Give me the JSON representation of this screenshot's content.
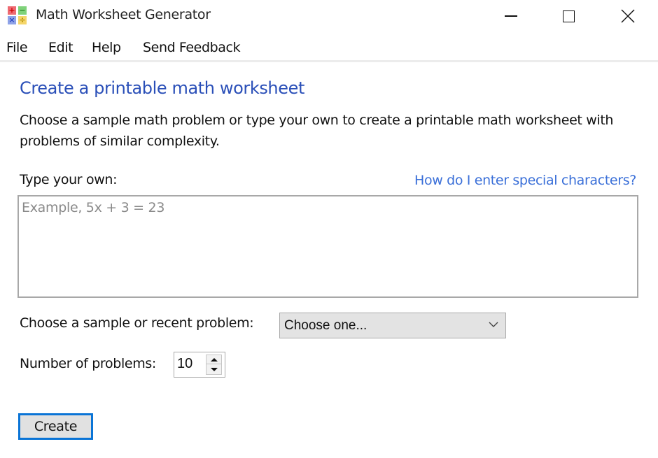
{
  "window": {
    "title": "Math Worksheet Generator",
    "app_icon": "math-operators-icon",
    "controls": {
      "minimize_icon": "minimize-icon",
      "maximize_icon": "maximize-icon",
      "close_icon": "close-icon"
    }
  },
  "menu": {
    "items": [
      {
        "label": "File"
      },
      {
        "label": "Edit"
      },
      {
        "label": "Help"
      },
      {
        "label": "Send Feedback"
      }
    ]
  },
  "main": {
    "heading": "Create a printable math worksheet",
    "description": "Choose a sample math problem or type your own to create a printable math worksheet with problems of similar complexity.",
    "type_own": {
      "label": "Type your own:",
      "help_link": "How do I enter special characters?",
      "value": "",
      "placeholder": "Example, 5x + 3 = 23"
    },
    "sample": {
      "label": "Choose a sample or recent problem:",
      "selected": "Choose one..."
    },
    "count": {
      "label": "Number of problems:",
      "value": "10"
    },
    "create_label": "Create"
  },
  "colors": {
    "heading": "#2a4fb8",
    "link": "#3a6fd8",
    "focus_border": "#0a74d6"
  }
}
